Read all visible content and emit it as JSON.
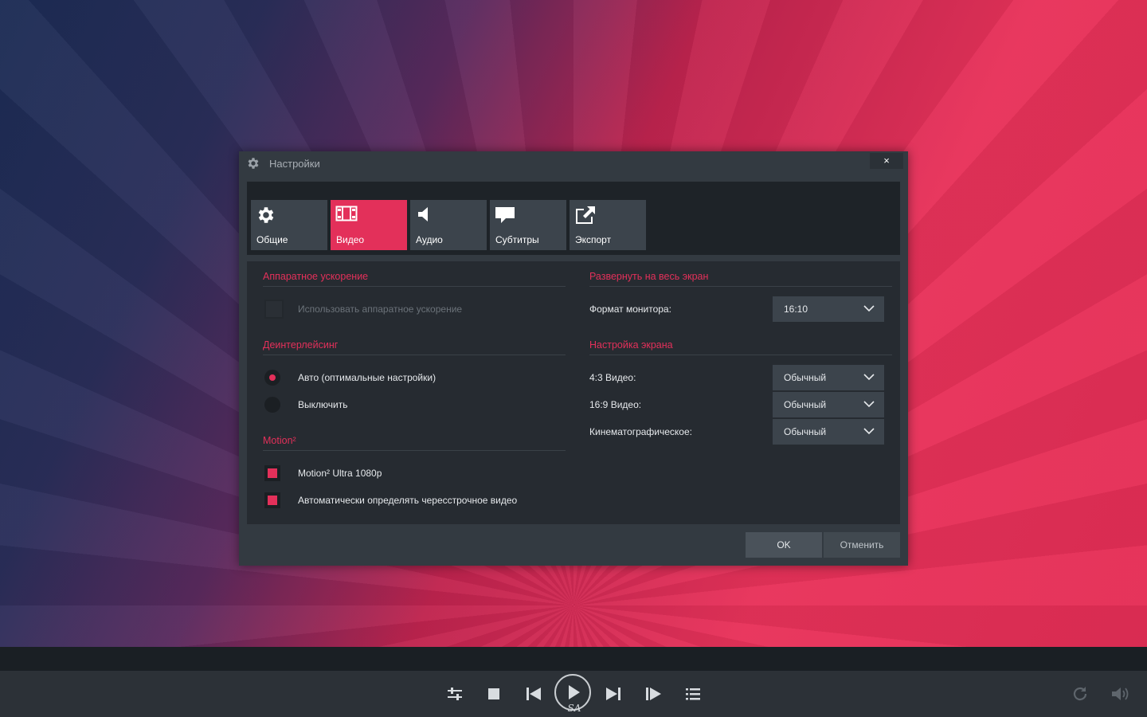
{
  "dialog": {
    "title": "Настройки",
    "close": "×",
    "tabs": [
      {
        "label": "Общие",
        "icon": "gear-icon"
      },
      {
        "label": "Видео",
        "icon": "film-icon",
        "active": true
      },
      {
        "label": "Аудио",
        "icon": "speaker-icon"
      },
      {
        "label": "Субтитры",
        "icon": "speech-bubble-icon"
      },
      {
        "label": "Экспорт",
        "icon": "export-icon"
      }
    ],
    "left": {
      "hw_title": "Аппаратное ускорение",
      "hw_label": "Использовать аппаратное ускорение",
      "deint_title": "Деинтерлейсинг",
      "deint_auto": "Авто (оптимальные настройки)",
      "deint_off": "Выключить",
      "motion_title": "Motion²",
      "motion_ultra": "Motion² Ultra 1080p",
      "motion_auto": "Автоматически определять чересстрочное видео"
    },
    "right": {
      "fullscreen_title": "Развернуть на весь экран",
      "monitor_label": "Формат монитора:",
      "monitor_value": "16:10",
      "screen_title": "Настройка экрана",
      "v43_label": "4:3 Видео:",
      "v43_value": "Обычный",
      "v169_label": "16:9 Видео:",
      "v169_value": "Обычный",
      "cine_label": "Кинематографическое:",
      "cine_value": "Обычный"
    },
    "ok": "OK",
    "cancel": "Отменить"
  },
  "player": {
    "play_sub": "SA"
  },
  "colors": {
    "accent": "#e3305a",
    "dialog_bg": "#333a41",
    "content_bg": "#262b31"
  }
}
